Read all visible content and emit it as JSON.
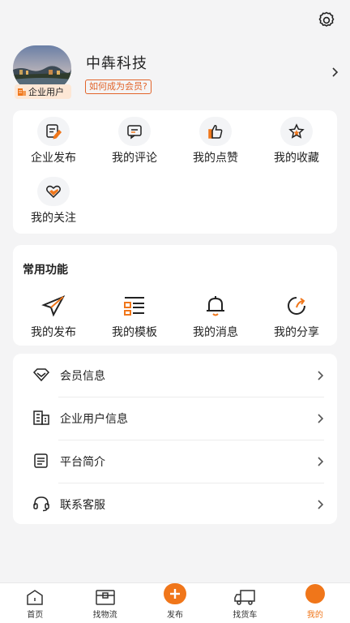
{
  "header": {
    "settings_icon": "gear-icon"
  },
  "profile": {
    "company_name": "中犇科技",
    "member_link": "如何成为会员?",
    "badge": "企业用户"
  },
  "quick_actions": [
    {
      "label": "企业发布",
      "icon": "edit-document-icon"
    },
    {
      "label": "我的评论",
      "icon": "comment-icon"
    },
    {
      "label": "我的点赞",
      "icon": "thumbs-up-icon"
    },
    {
      "label": "我的收藏",
      "icon": "star-icon"
    },
    {
      "label": "我的关注",
      "icon": "heart-icon"
    }
  ],
  "common_functions": {
    "title": "常用功能",
    "items": [
      {
        "label": "我的发布",
        "icon": "paper-plane-icon"
      },
      {
        "label": "我的模板",
        "icon": "template-icon"
      },
      {
        "label": "我的消息",
        "icon": "bell-icon"
      },
      {
        "label": "我的分享",
        "icon": "share-icon"
      }
    ]
  },
  "menu_list": [
    {
      "label": "会员信息",
      "icon": "diamond-icon"
    },
    {
      "label": "企业用户信息",
      "icon": "building-icon"
    },
    {
      "label": "平台简介",
      "icon": "document-icon"
    },
    {
      "label": "联系客服",
      "icon": "headset-icon"
    }
  ],
  "bottom_nav": [
    {
      "label": "首页",
      "icon": "home-icon"
    },
    {
      "label": "找物流",
      "icon": "logistics-box-icon"
    },
    {
      "label": "发布",
      "icon": "plus-icon"
    },
    {
      "label": "找货车",
      "icon": "truck-icon"
    },
    {
      "label": "我的",
      "icon": "profile-icon"
    }
  ],
  "colors": {
    "accent": "#f0761a",
    "link": "#e2642a",
    "background": "#f4f4f5"
  }
}
